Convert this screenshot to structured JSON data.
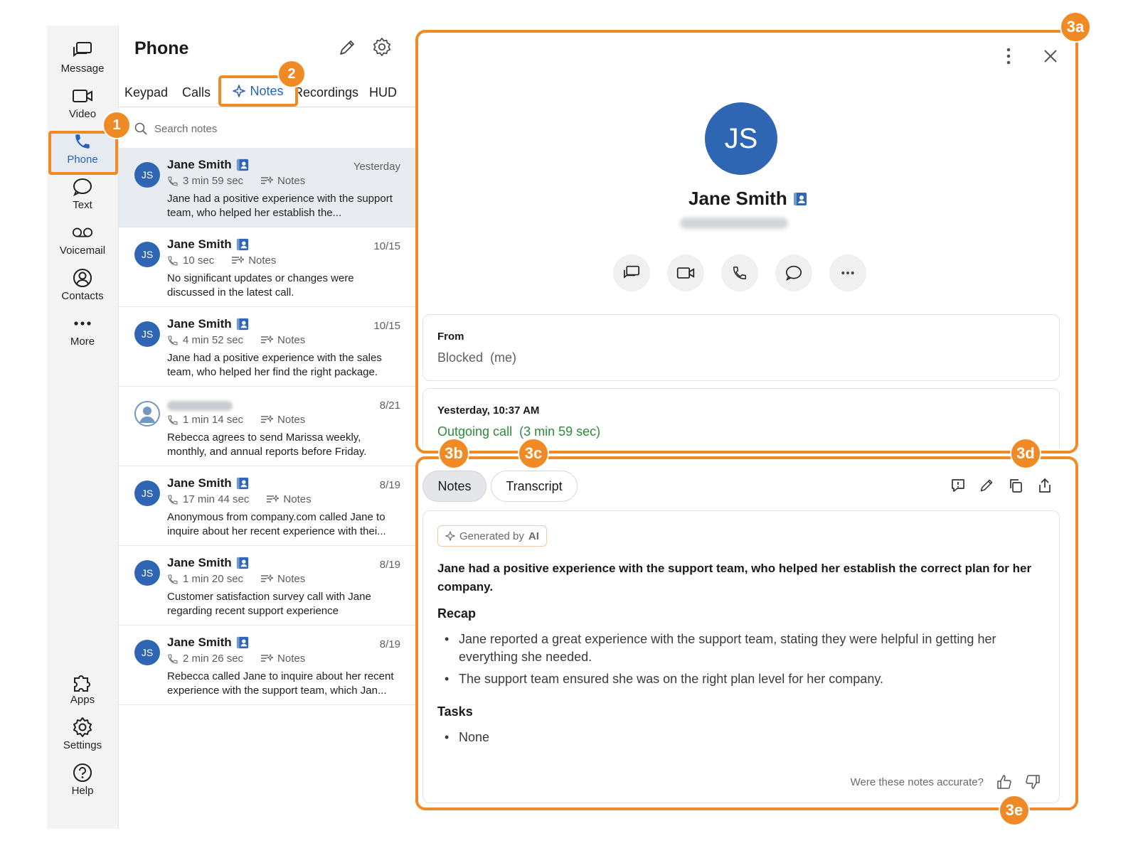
{
  "rail": {
    "items": [
      {
        "label": "Message",
        "icon": "message-icon"
      },
      {
        "label": "Video",
        "icon": "video-icon"
      },
      {
        "label": "Phone",
        "icon": "phone-icon"
      },
      {
        "label": "Text",
        "icon": "text-bubble-icon"
      },
      {
        "label": "Voicemail",
        "icon": "voicemail-icon"
      },
      {
        "label": "Contacts",
        "icon": "contacts-icon"
      },
      {
        "label": "More",
        "icon": "more-dots-icon"
      }
    ],
    "bottom": [
      {
        "label": "Apps",
        "icon": "puzzle-icon"
      },
      {
        "label": "Settings",
        "icon": "gear-icon"
      },
      {
        "label": "Help",
        "icon": "help-icon"
      }
    ]
  },
  "phone": {
    "title": "Phone",
    "tabs": [
      "Keypad",
      "Calls",
      "Notes",
      "Recordings",
      "HUD"
    ],
    "search_placeholder": "Search notes",
    "notes": [
      {
        "name": "Jane Smith",
        "initials": "JS",
        "date": "Yesterday",
        "duration": "3 min 59 sec",
        "tag": "Notes",
        "preview": "Jane had a positive experience with the support team, who helped her establish the..."
      },
      {
        "name": "Jane Smith",
        "initials": "JS",
        "date": "10/15",
        "duration": "10 sec",
        "tag": "Notes",
        "preview": "No significant updates or changes were discussed in the latest call."
      },
      {
        "name": "Jane Smith",
        "initials": "JS",
        "date": "10/15",
        "duration": "4 min 52 sec",
        "tag": "Notes",
        "preview": "Jane had a positive experience with the sales team, who helped her find the right package."
      },
      {
        "name": "",
        "initials": "",
        "date": "8/21",
        "duration": "1 min 14 sec",
        "tag": "Notes",
        "preview": "Rebecca agrees to send Marissa weekly, monthly, and annual reports before Friday."
      },
      {
        "name": "Jane Smith",
        "initials": "JS",
        "date": "8/19",
        "duration": "17 min 44 sec",
        "tag": "Notes",
        "preview": "Anonymous from company.com called Jane to inquire about her recent experience with thei..."
      },
      {
        "name": "Jane Smith",
        "initials": "JS",
        "date": "8/19",
        "duration": "1 min 20 sec",
        "tag": "Notes",
        "preview": "Customer satisfaction survey call with Jane regarding recent support experience"
      },
      {
        "name": "Jane Smith",
        "initials": "JS",
        "date": "8/19",
        "duration": "2 min 26 sec",
        "tag": "Notes",
        "preview": "Rebecca called Jane to inquire about her recent experience with the support team, which Jan..."
      }
    ]
  },
  "badges": {
    "b1": "1",
    "b2": "2",
    "b3a": "3a",
    "b3b": "3b",
    "b3c": "3c",
    "b3d": "3d",
    "b3e": "3e"
  },
  "detail": {
    "initials": "JS",
    "name": "Jane Smith",
    "from_label": "From",
    "from_value": "Blocked",
    "from_me": "(me)",
    "when": "Yesterday, 10:37 AM",
    "call_type": "Outgoing call",
    "call_duration": "(3 min 59 sec)",
    "accent_green": "#2e8b3a"
  },
  "notes_panel": {
    "tab_notes": "Notes",
    "tab_transcript": "Transcript",
    "ai_label": "Generated by",
    "ai_tag": "AI",
    "summary": "Jane had a positive experience with the support team, who helped her establish the correct plan for her company.",
    "recap_title": "Recap",
    "recap": [
      "Jane reported a great experience with the support team, stating they were helpful in getting her everything she needed.",
      "The support team ensured she was on the right plan level for her company."
    ],
    "tasks_title": "Tasks",
    "tasks": [
      "None"
    ],
    "feedback_question": "Were these notes accurate?"
  },
  "colors": {
    "highlight": "#f08a24",
    "brand_blue": "#2f66b3",
    "active_blue": "#2563b8"
  }
}
